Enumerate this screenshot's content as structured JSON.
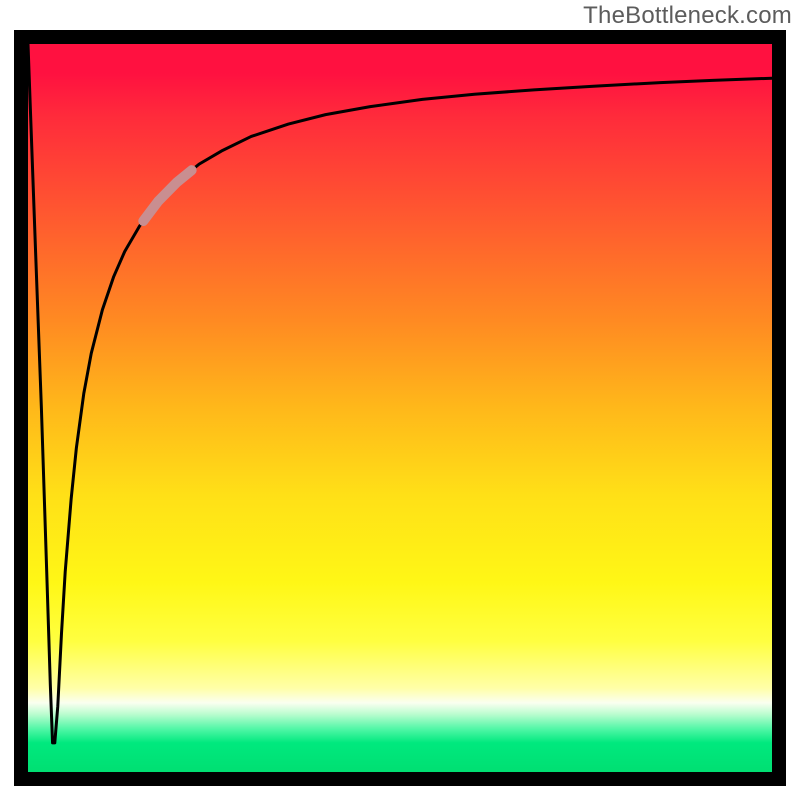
{
  "watermark": {
    "text": "TheBottleneck.com"
  },
  "chart_data": {
    "type": "line",
    "title": "",
    "xlabel": "",
    "ylabel": "",
    "xlim": [
      0,
      100
    ],
    "ylim": [
      0,
      100
    ],
    "grid": false,
    "legend": false,
    "gradient_stops": [
      {
        "pct": 0,
        "color": "#ff1140"
      },
      {
        "pct": 4,
        "color": "#ff1140"
      },
      {
        "pct": 10,
        "color": "#ff2b3b"
      },
      {
        "pct": 24,
        "color": "#ff5a2f"
      },
      {
        "pct": 38,
        "color": "#ff8a22"
      },
      {
        "pct": 50,
        "color": "#ffb81a"
      },
      {
        "pct": 62,
        "color": "#ffe017"
      },
      {
        "pct": 74,
        "color": "#fff716"
      },
      {
        "pct": 82,
        "color": "#ffff40"
      },
      {
        "pct": 88.5,
        "color": "#ffffa8"
      },
      {
        "pct": 90.5,
        "color": "#fafff0"
      },
      {
        "pct": 92,
        "color": "#bdfdd0"
      },
      {
        "pct": 94,
        "color": "#55f7a8"
      },
      {
        "pct": 96,
        "color": "#00e97e"
      },
      {
        "pct": 100,
        "color": "#00df72"
      }
    ],
    "series": [
      {
        "name": "bottleneck-curve",
        "color": "#000000",
        "x": [
          0.0,
          0.5,
          1.0,
          1.8,
          2.5,
          3.0,
          3.3,
          3.6,
          4.0,
          4.5,
          5.0,
          5.8,
          6.5,
          7.5,
          8.5,
          10.0,
          11.5,
          13.0,
          15.0,
          17.5,
          20.0,
          23.0,
          26.0,
          30.0,
          35.0,
          40.0,
          46.0,
          53.0,
          60.0,
          68.0,
          76.0,
          85.0,
          92.0,
          100.0
        ],
        "y": [
          100.0,
          86.0,
          72.0,
          50.0,
          28.0,
          12.0,
          4.0,
          4.0,
          9.0,
          19.0,
          27.5,
          37.5,
          44.5,
          52.0,
          57.5,
          63.5,
          68.0,
          71.5,
          75.0,
          78.4,
          81.0,
          83.5,
          85.3,
          87.3,
          89.0,
          90.3,
          91.4,
          92.4,
          93.1,
          93.7,
          94.2,
          94.7,
          95.0,
          95.3
        ]
      }
    ],
    "highlight_segment": {
      "x_start": 15.5,
      "x_end": 22.0,
      "color": "#c98e90"
    },
    "curve_minimum": {
      "x": 3.45,
      "y": 3.5
    }
  }
}
